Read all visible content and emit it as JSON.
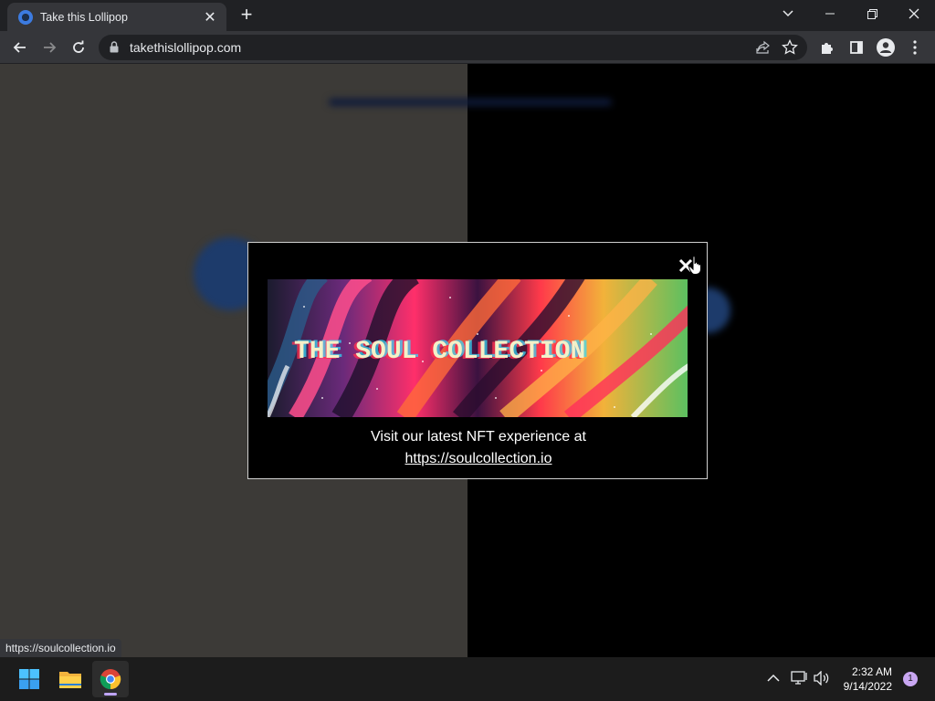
{
  "browser": {
    "tab": {
      "title": "Take this Lollipop",
      "close_glyph": "✕"
    },
    "new_tab_glyph": "+",
    "window_controls": {
      "menu_glyph": "⌄",
      "minimize_glyph": "–",
      "restore_glyph": "❐",
      "close_glyph": "✕"
    },
    "address_bar": {
      "url": "takethislollipop.com"
    },
    "status_url": "https://soulcollection.io"
  },
  "modal": {
    "banner_text": "THE SOUL COLLECTION",
    "message": "Visit our latest NFT experience at",
    "link_text": "https://soulcollection.io"
  },
  "taskbar": {
    "apps": [
      "start-menu",
      "file-explorer",
      "google-chrome"
    ],
    "clock": {
      "time": "2:32 AM",
      "date": "9/14/2022"
    },
    "notification_count": "1"
  },
  "colors": {
    "chrome_dark": "#202124",
    "chrome_toolbar": "#35363a",
    "page_left_bg": "#3c3a37",
    "page_right_bg": "#000000",
    "taskbar_bg": "#1c1c1c",
    "notification_badge": "#c9a7f2"
  }
}
